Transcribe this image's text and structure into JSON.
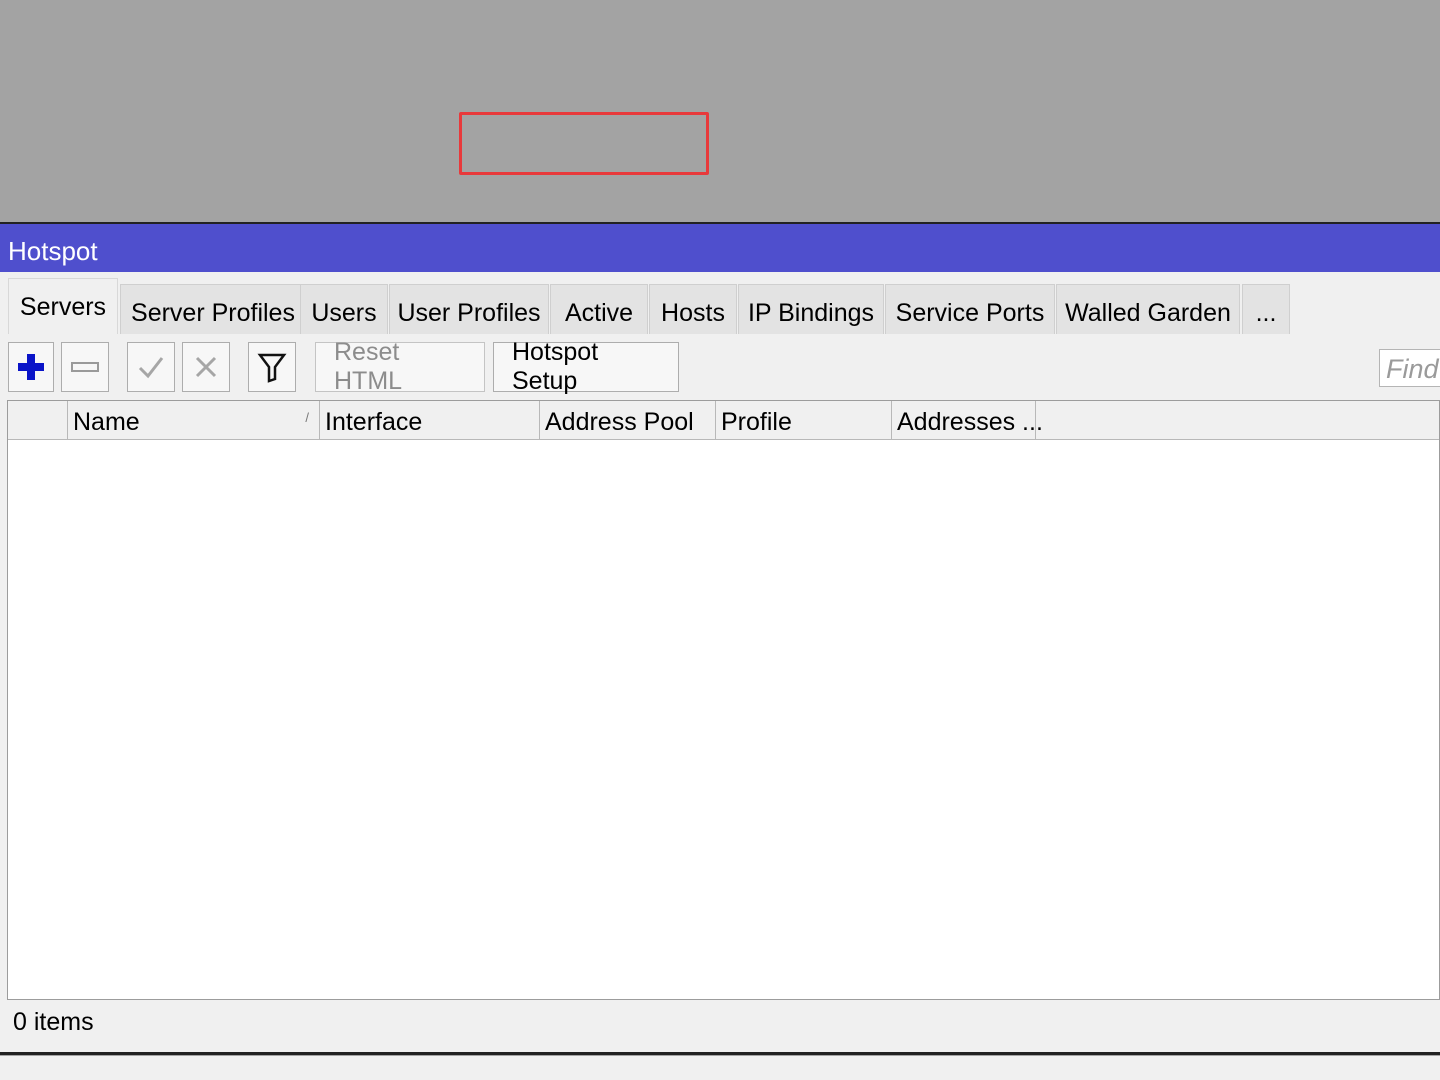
{
  "window": {
    "title": "Hotspot"
  },
  "tabs": [
    {
      "label": "Servers"
    },
    {
      "label": "Server Profiles"
    },
    {
      "label": "Users"
    },
    {
      "label": "User Profiles"
    },
    {
      "label": "Active"
    },
    {
      "label": "Hosts"
    },
    {
      "label": "IP Bindings"
    },
    {
      "label": "Service Ports"
    },
    {
      "label": "Walled Garden"
    },
    {
      "label": "..."
    }
  ],
  "toolbar": {
    "add_icon": "plus-icon",
    "remove_icon": "minus-icon",
    "enable_icon": "check-icon",
    "disable_icon": "x-icon",
    "filter_icon": "filter-icon",
    "reset_html_label": "Reset HTML",
    "hotspot_setup_label": "Hotspot Setup",
    "find_placeholder": "Find"
  },
  "table": {
    "columns": [
      "Name",
      "Interface",
      "Address Pool",
      "Profile",
      "Addresses ..."
    ]
  },
  "status": {
    "items_text": "0 items"
  },
  "colors": {
    "titlebar": "#4f4fcd",
    "highlight": "#e8393b",
    "add_icon": "#0a14c8"
  }
}
